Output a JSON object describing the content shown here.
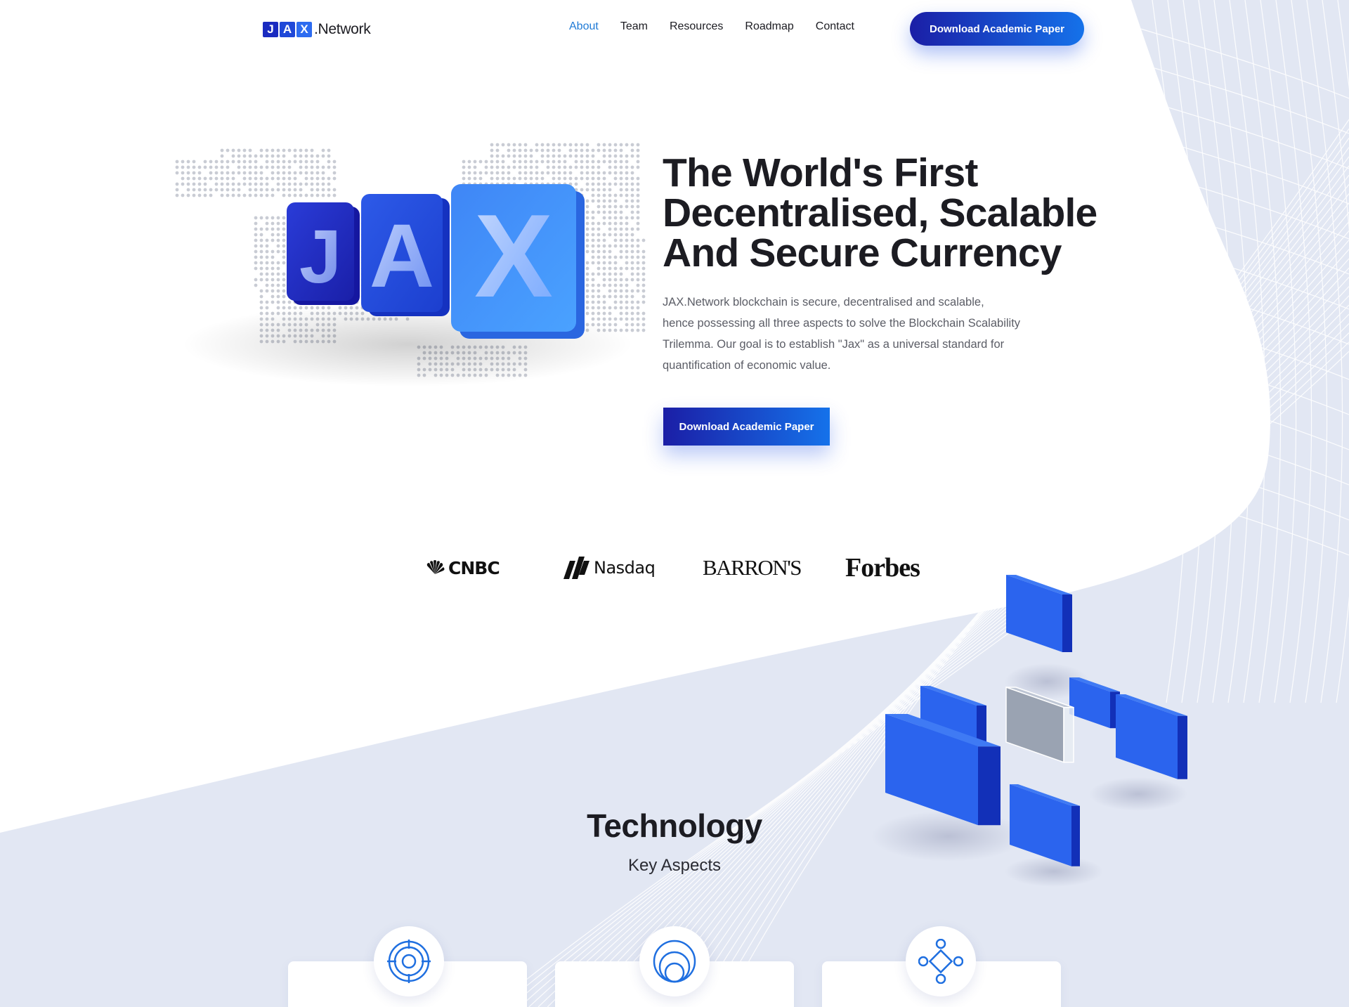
{
  "header": {
    "logo": {
      "letters": [
        "J",
        "A",
        "X"
      ],
      "text": ".Network"
    },
    "nav": [
      "About",
      "Team",
      "Resources",
      "Roadmap",
      "Contact"
    ],
    "active_nav": "About",
    "cta_label": "Download Academic Paper"
  },
  "hero": {
    "title_lines": [
      "The World's First",
      "Decentralised, Scalable",
      "And Secure Currency"
    ],
    "description_lines": [
      "JAX.Network blockchain is secure, decentralised and scalable,",
      "hence possessing all three aspects to solve the Blockchain Scalability",
      "Trilemma. Our goal is to establish \"Jax\" as a universal standard for",
      "quantification of economic value."
    ],
    "cta_label": "Download Academic Paper",
    "art_letters": [
      "J",
      "A",
      "X"
    ]
  },
  "press": {
    "logos": [
      "CNBC",
      "Nasdaq",
      "BARRON'S",
      "Forbes"
    ]
  },
  "technology": {
    "title": "Technology",
    "subtitle": "Key Aspects",
    "feature_icons": [
      "target-icon",
      "concentric-circles-icon",
      "network-nodes-icon"
    ]
  },
  "colors": {
    "brand_dark": "#1b1ea6",
    "brand_light": "#1572ea",
    "active_nav": "#1f7ad6",
    "section_bg": "#e2e7f3",
    "cube_blue": "#1f5fe8"
  }
}
